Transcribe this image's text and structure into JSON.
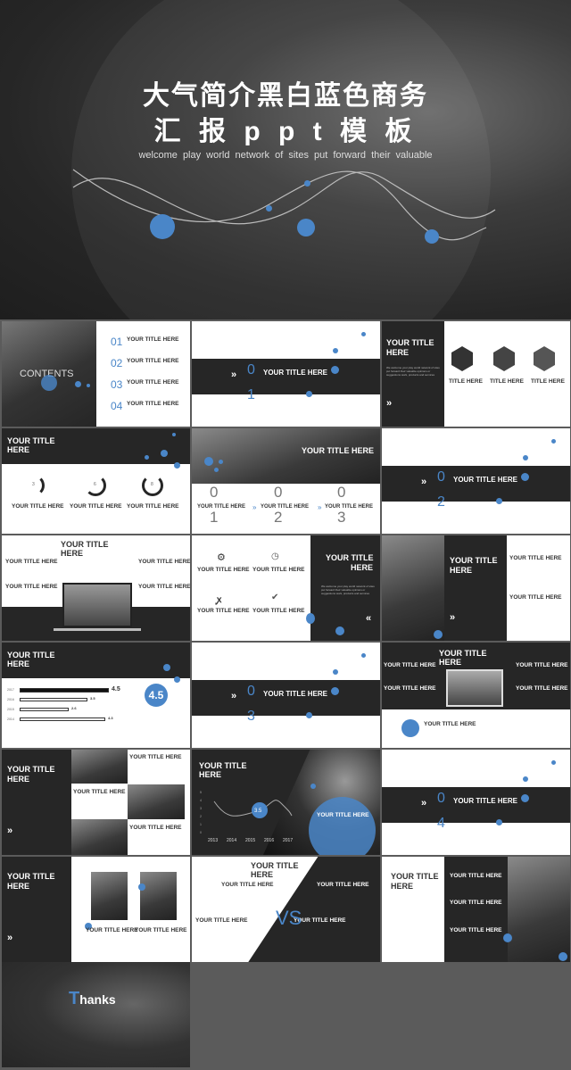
{
  "hero": {
    "title_line1": "大气简介黑白蓝色商务",
    "title_line2": "汇 报 p p t 模 板",
    "subtitle": "welcome play world network of sites put forward their valuable"
  },
  "colors": {
    "accent": "#4a86c8",
    "dark": "#262626",
    "background": "#5b5b5b"
  },
  "common": {
    "title": "YOUR TITLE HERE",
    "title_short_1": "YOUR TITLE",
    "title_short_2": "HERE",
    "title_here": "TITLE HERE",
    "body": "We welcome your play world network of sites put",
    "body_long": "We welcome your play world network of sites put forward their valuable opinions or suggestions work, products and services",
    "chevron_right": "»",
    "chevron_left": "«"
  },
  "contents": {
    "label": "CONTENTS",
    "items": [
      "01",
      "02",
      "03",
      "04"
    ]
  },
  "sections": [
    {
      "digit1": "0",
      "digit2": "1"
    },
    {
      "digit1": "0",
      "digit2": "2"
    },
    {
      "digit1": "0",
      "digit2": "3"
    },
    {
      "digit1": "0",
      "digit2": "4"
    }
  ],
  "rings": [
    {
      "label": "3",
      "value": 30
    },
    {
      "label": "6",
      "value": 60
    },
    {
      "label": "8",
      "value": 80
    }
  ],
  "steps": [
    {
      "d1": "0",
      "d2": "1"
    },
    {
      "d1": "0",
      "d2": "2"
    },
    {
      "d1": "0",
      "d2": "3"
    }
  ],
  "icons": [
    "gear-icon",
    "timer-icon",
    "route-icon",
    "check-circle-icon"
  ],
  "bars": {
    "rows": [
      {
        "year": "2017",
        "value": "4.5"
      },
      {
        "year": "2016",
        "value": "3.5"
      },
      {
        "year": "2015",
        "value": "2.6"
      },
      {
        "year": "2014",
        "value": "4.3"
      }
    ],
    "highlight": "4.5"
  },
  "line_chart": {
    "x": [
      "2013",
      "2014",
      "2015",
      "2016",
      "2017"
    ],
    "y_ticks": [
      "0",
      "1",
      "2",
      "3",
      "4",
      "5"
    ],
    "highlight": "3.5"
  },
  "vs": "VS",
  "thanks": {
    "first": "T",
    "rest": "hanks"
  }
}
